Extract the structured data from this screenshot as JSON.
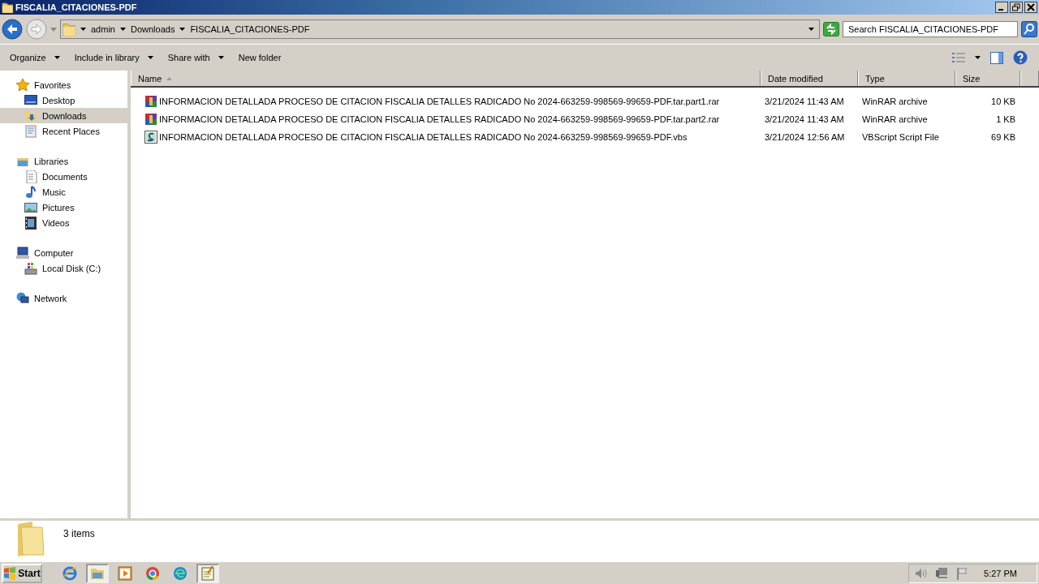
{
  "window": {
    "title": "FISCALIA_CITACIONES-PDF"
  },
  "address_bar": {
    "crumbs": [
      "admin",
      "Downloads",
      "FISCALIA_CITACIONES-PDF"
    ]
  },
  "search": {
    "placeholder": "Search FISCALIA_CITACIONES-PDF"
  },
  "toolbar": {
    "buttons": [
      {
        "label": "Organize",
        "dropdown": true
      },
      {
        "label": "Include in library",
        "dropdown": true
      },
      {
        "label": "Share with",
        "dropdown": true
      },
      {
        "label": "New folder",
        "dropdown": false
      }
    ]
  },
  "sidebar": {
    "groups": [
      {
        "label": "Favorites",
        "children": [
          {
            "label": "Desktop",
            "selected": false
          },
          {
            "label": "Downloads",
            "selected": true
          },
          {
            "label": "Recent Places",
            "selected": false
          }
        ]
      },
      {
        "label": "Libraries",
        "children": [
          {
            "label": "Documents",
            "selected": false
          },
          {
            "label": "Music",
            "selected": false
          },
          {
            "label": "Pictures",
            "selected": false
          },
          {
            "label": "Videos",
            "selected": false
          }
        ]
      },
      {
        "label": "Computer",
        "children": [
          {
            "label": "Local Disk (C:)",
            "selected": false
          }
        ]
      },
      {
        "label": "Network"
      }
    ]
  },
  "table": {
    "columns": [
      {
        "label": "Name",
        "sorted": true
      },
      {
        "label": "Date modified",
        "sorted": false
      },
      {
        "label": "Type",
        "sorted": false
      },
      {
        "label": "Size",
        "sorted": false
      }
    ],
    "rows": [
      {
        "kind": "archive",
        "selected": false,
        "name": "INFORMACION DETALLADA PROCESO DE CITACION FISCALIA DETALLES RADICADO No 2024-663259-998569-99659-PDF.tar.part1.rar",
        "date": "3/21/2024 11:43 AM",
        "type": "WinRAR archive",
        "size": "10 KB"
      },
      {
        "kind": "archive",
        "selected": false,
        "name": "INFORMACION DETALLADA PROCESO DE CITACION FISCALIA DETALLES RADICADO No 2024-663259-998569-99659-PDF.tar.part2.rar",
        "date": "3/21/2024 11:43 AM",
        "type": "WinRAR archive",
        "size": "1 KB"
      },
      {
        "kind": "script",
        "selected": false,
        "name": "INFORMACION DETALLADA PROCESO DE CITACION FISCALIA DETALLES RADICADO No 2024-663259-998569-99659-PDF.vbs",
        "date": "3/21/2024 12:56 AM",
        "type": "VBScript Script File",
        "size": "69 KB"
      }
    ]
  },
  "status_bar": {
    "count": "3 items"
  },
  "taskbar": {
    "start": "Start",
    "apps": [
      {
        "active": false
      },
      {
        "active": true
      },
      {
        "active": false
      },
      {
        "active": false
      },
      {
        "active": false
      },
      {
        "active": true
      }
    ],
    "clock": "5:27 PM"
  }
}
